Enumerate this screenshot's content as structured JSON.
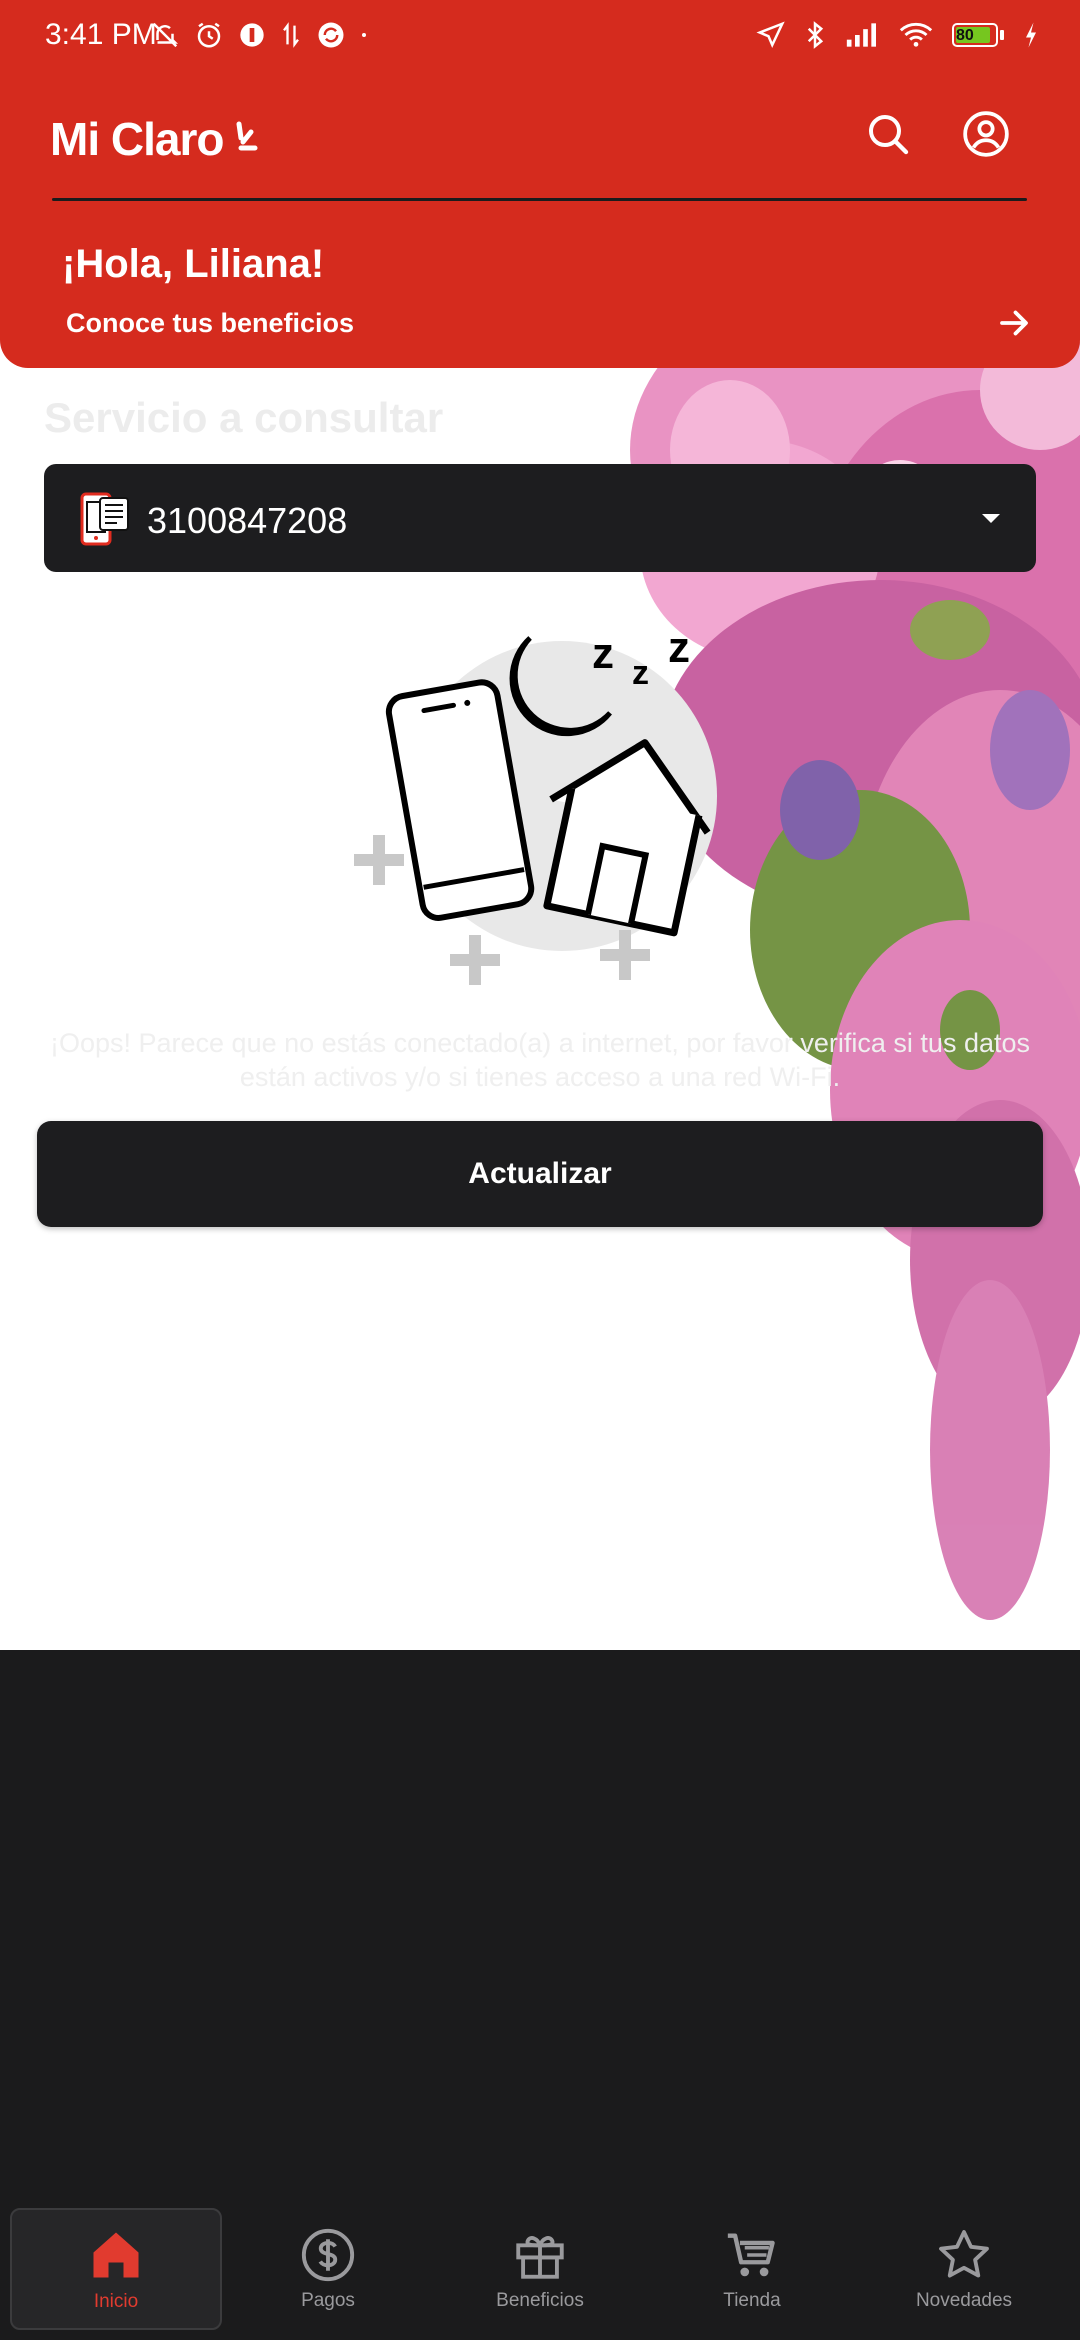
{
  "status_bar": {
    "time": "3:41 PM",
    "battery": "80",
    "icons_left": [
      "mute-icon",
      "alarm-icon",
      "app-icon",
      "data-transfer-icon",
      "sync-icon",
      "dot-icon"
    ],
    "icons_right": [
      "location-icon",
      "bluetooth-icon",
      "signal-icon",
      "wifi-icon",
      "battery-icon",
      "charging-icon"
    ]
  },
  "header": {
    "logo_text": "Mi Claro",
    "greeting": "¡Hola, Liliana!",
    "benefits_link": "Conoce tus beneficios",
    "search_icon": "search-icon",
    "account_icon": "account-icon",
    "arrow_icon": "arrow-right-icon"
  },
  "main": {
    "section_title": "Servicio a consultar",
    "service_number": "3100847208",
    "offline_message": "¡Oops! Parece que no estás conectado(a) a internet, por favor verifica si tus datos están activos y/o si tienes acceso a una red Wi-Fi.",
    "refresh_button": "Actualizar"
  },
  "bottom_nav": {
    "items": [
      {
        "label": "Inicio",
        "icon": "home-icon",
        "active": true
      },
      {
        "label": "Pagos",
        "icon": "dollar-icon",
        "active": false
      },
      {
        "label": "Beneficios",
        "icon": "gift-icon",
        "active": false
      },
      {
        "label": "Tienda",
        "icon": "cart-icon",
        "active": false
      },
      {
        "label": "Novedades",
        "icon": "star-icon",
        "active": false
      }
    ]
  },
  "colors": {
    "brand_red": "#d52b1e",
    "dark_bg": "#1b1b1c",
    "active_nav": "#e13b2f"
  }
}
